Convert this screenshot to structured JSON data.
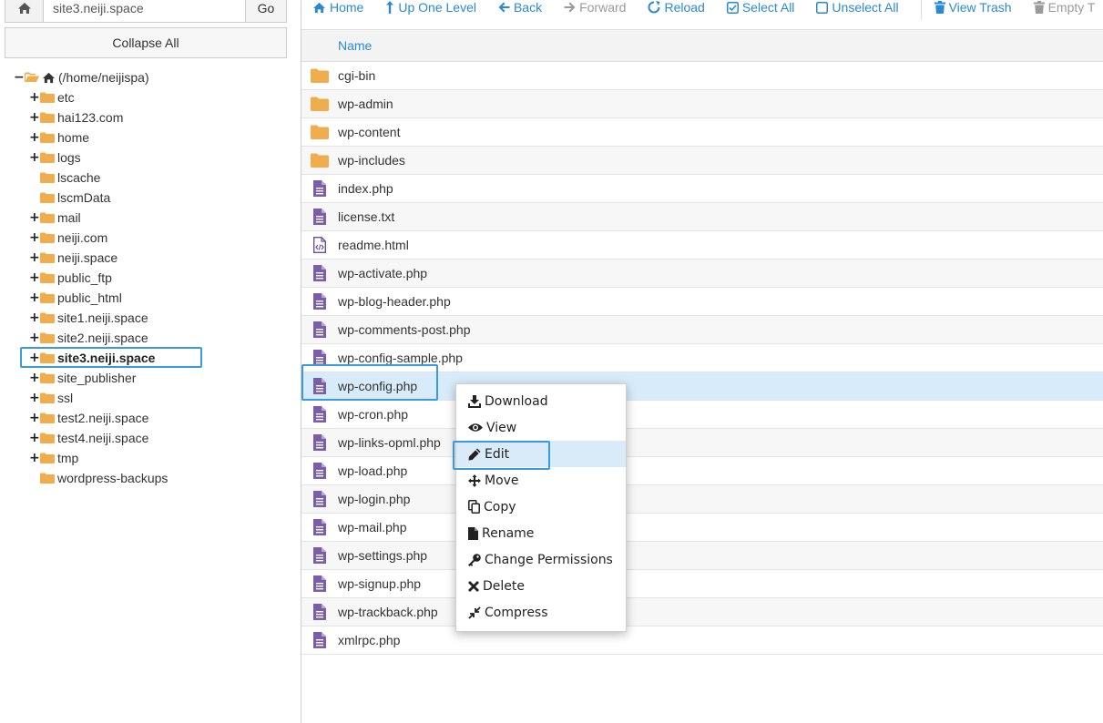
{
  "path_bar": {
    "value": "site3.neiji.space",
    "go_label": "Go",
    "home_icon": "home-icon"
  },
  "collapse_all_label": "Collapse All",
  "tree": {
    "root_label": "(/home/neijispa)",
    "items": [
      {
        "label": "etc",
        "expandable": true
      },
      {
        "label": "hai123.com",
        "expandable": true
      },
      {
        "label": "home",
        "expandable": true
      },
      {
        "label": "logs",
        "expandable": true
      },
      {
        "label": "lscache",
        "expandable": false
      },
      {
        "label": "lscmData",
        "expandable": false
      },
      {
        "label": "mail",
        "expandable": true
      },
      {
        "label": "neiji.com",
        "expandable": true
      },
      {
        "label": "neiji.space",
        "expandable": true
      },
      {
        "label": "public_ftp",
        "expandable": true
      },
      {
        "label": "public_html",
        "expandable": true
      },
      {
        "label": "site1.neiji.space",
        "expandable": true
      },
      {
        "label": "site2.neiji.space",
        "expandable": true
      },
      {
        "label": "site3.neiji.space",
        "expandable": true,
        "selected": true
      },
      {
        "label": "site_publisher",
        "expandable": true
      },
      {
        "label": "ssl",
        "expandable": true
      },
      {
        "label": "test2.neiji.space",
        "expandable": true
      },
      {
        "label": "test4.neiji.space",
        "expandable": true
      },
      {
        "label": "tmp",
        "expandable": true
      },
      {
        "label": "wordpress-backups",
        "expandable": false
      }
    ]
  },
  "toolbar": {
    "home": "Home",
    "up_one_level": "Up One Level",
    "back": "Back",
    "forward": "Forward",
    "reload": "Reload",
    "select_all": "Select All",
    "unselect_all": "Unselect All",
    "view_trash": "View Trash",
    "empty_trash": "Empty T"
  },
  "file_list": {
    "header_name": "Name",
    "files": [
      {
        "name": "cgi-bin",
        "icon": "folder-icon"
      },
      {
        "name": "wp-admin",
        "icon": "folder-icon"
      },
      {
        "name": "wp-content",
        "icon": "folder-icon"
      },
      {
        "name": "wp-includes",
        "icon": "folder-icon"
      },
      {
        "name": "index.php",
        "icon": "file-text-icon"
      },
      {
        "name": "license.txt",
        "icon": "file-text-icon"
      },
      {
        "name": "readme.html",
        "icon": "file-code-icon"
      },
      {
        "name": "wp-activate.php",
        "icon": "file-text-icon"
      },
      {
        "name": "wp-blog-header.php",
        "icon": "file-text-icon"
      },
      {
        "name": "wp-comments-post.php",
        "icon": "file-text-icon"
      },
      {
        "name": "wp-config-sample.php",
        "icon": "file-text-icon"
      },
      {
        "name": "wp-config.php",
        "icon": "file-text-icon",
        "selected": true
      },
      {
        "name": "wp-cron.php",
        "icon": "file-text-icon"
      },
      {
        "name": "wp-links-opml.php",
        "icon": "file-text-icon"
      },
      {
        "name": "wp-load.php",
        "icon": "file-text-icon"
      },
      {
        "name": "wp-login.php",
        "icon": "file-text-icon"
      },
      {
        "name": "wp-mail.php",
        "icon": "file-text-icon"
      },
      {
        "name": "wp-settings.php",
        "icon": "file-text-icon"
      },
      {
        "name": "wp-signup.php",
        "icon": "file-text-icon"
      },
      {
        "name": "wp-trackback.php",
        "icon": "file-text-icon"
      },
      {
        "name": "xmlrpc.php",
        "icon": "file-text-icon"
      }
    ]
  },
  "context_menu": {
    "items": [
      {
        "label": "Download",
        "icon": "download-icon"
      },
      {
        "label": "View",
        "icon": "eye-icon"
      },
      {
        "label": "Edit",
        "icon": "pencil-icon",
        "highlighted": true
      },
      {
        "label": "Move",
        "icon": "move-icon"
      },
      {
        "label": "Copy",
        "icon": "copy-icon"
      },
      {
        "label": "Rename",
        "icon": "rename-icon"
      },
      {
        "label": "Change Permissions",
        "icon": "key-icon"
      },
      {
        "label": "Delete",
        "icon": "delete-icon"
      },
      {
        "label": "Compress",
        "icon": "compress-icon"
      }
    ]
  },
  "colors": {
    "accent": "#2a8ad0",
    "highlight_border": "#3a99e0",
    "selected_row": "#d8ebfa",
    "folder": "#f0ad4e",
    "file_icon": "#7b5ea8"
  }
}
